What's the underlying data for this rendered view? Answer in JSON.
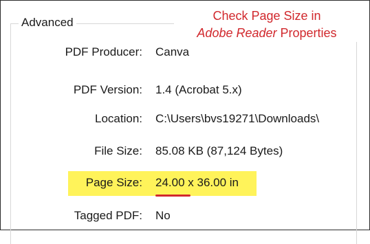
{
  "group": {
    "title": "Advanced"
  },
  "annotation": {
    "line1": "Check Page Size in",
    "line2_italic": "Adobe Reader",
    "line2_rest": " Properties",
    "color": "#d1282d"
  },
  "properties": [
    {
      "label": "PDF Producer:",
      "value": "Canva"
    },
    {
      "label": "PDF Version:",
      "value": "1.4 (Acrobat 5.x)"
    },
    {
      "label": "Location:",
      "value": "C:\\Users\\bvs19271\\Downloads\\"
    },
    {
      "label": "File Size:",
      "value": "85.08 KB (87,124 Bytes)"
    },
    {
      "label": "Page Size:",
      "value_part1": "24.00",
      "value_part2": " x 36.00 in"
    },
    {
      "label": "Tagged PDF:",
      "value": "No"
    }
  ],
  "colors": {
    "highlight": "#fff35a",
    "underline": "#d1282d"
  }
}
